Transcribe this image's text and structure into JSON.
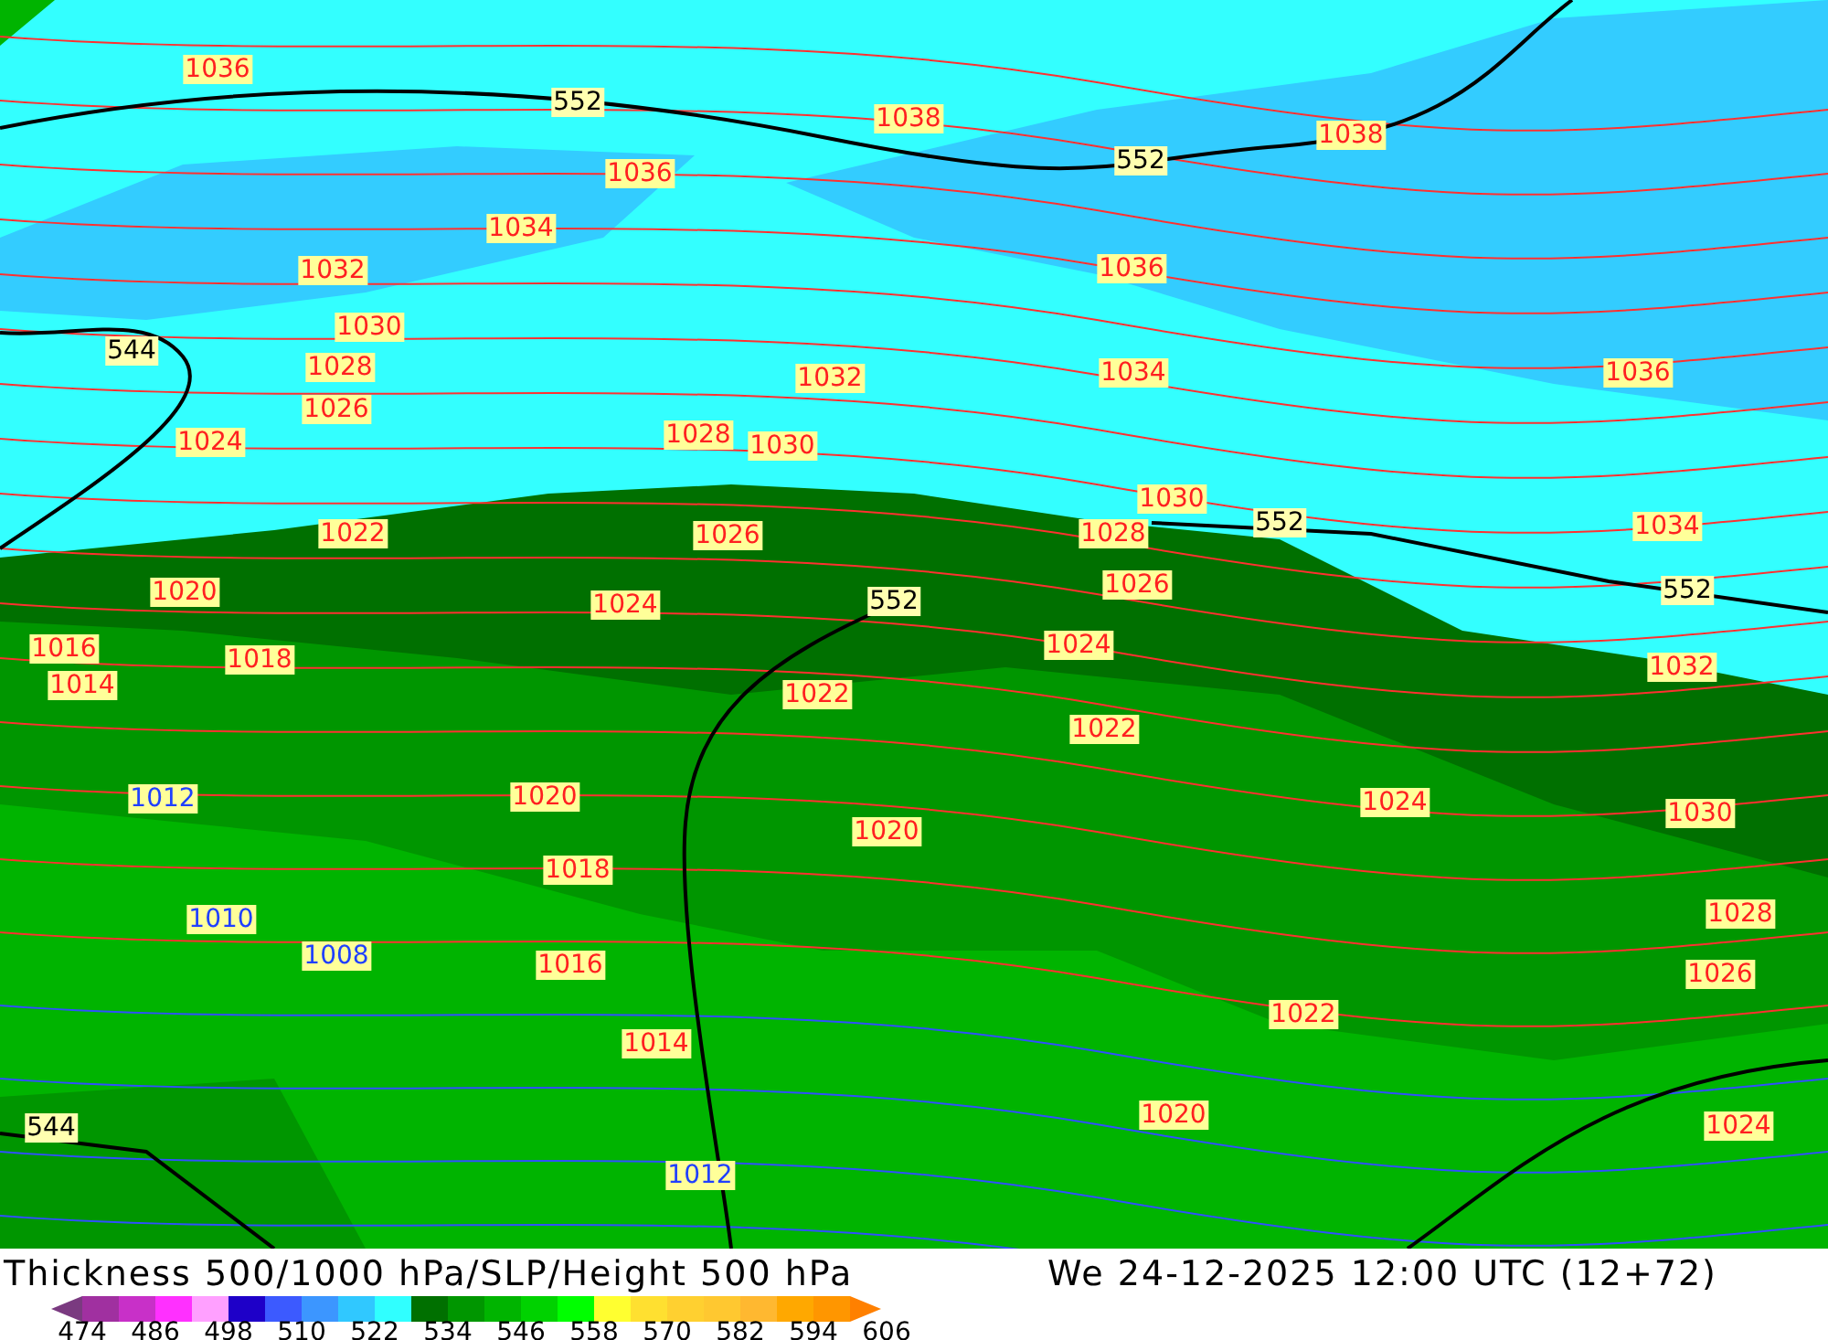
{
  "map": {
    "labels": [
      {
        "text": "1036",
        "kind": "slp"
      },
      {
        "text": "552",
        "kind": "height"
      },
      {
        "text": "1038",
        "kind": "slp"
      },
      {
        "text": "552",
        "kind": "height"
      },
      {
        "text": "1038",
        "kind": "slp"
      },
      {
        "text": "1036",
        "kind": "slp"
      },
      {
        "text": "1034",
        "kind": "slp"
      },
      {
        "text": "1032",
        "kind": "slp"
      },
      {
        "text": "1036",
        "kind": "slp"
      },
      {
        "text": "1030",
        "kind": "slp"
      },
      {
        "text": "544",
        "kind": "height"
      },
      {
        "text": "1028",
        "kind": "slp"
      },
      {
        "text": "1032",
        "kind": "slp"
      },
      {
        "text": "1034",
        "kind": "slp"
      },
      {
        "text": "1036",
        "kind": "slp"
      },
      {
        "text": "1026",
        "kind": "slp"
      },
      {
        "text": "1024",
        "kind": "slp"
      },
      {
        "text": "1028",
        "kind": "slp"
      },
      {
        "text": "1030",
        "kind": "slp"
      },
      {
        "text": "1030",
        "kind": "slp"
      },
      {
        "text": "552",
        "kind": "height"
      },
      {
        "text": "1022",
        "kind": "slp"
      },
      {
        "text": "1026",
        "kind": "slp"
      },
      {
        "text": "1028",
        "kind": "slp"
      },
      {
        "text": "1034",
        "kind": "slp"
      },
      {
        "text": "1020",
        "kind": "slp"
      },
      {
        "text": "1024",
        "kind": "slp"
      },
      {
        "text": "552",
        "kind": "height"
      },
      {
        "text": "1026",
        "kind": "slp"
      },
      {
        "text": "552",
        "kind": "height"
      },
      {
        "text": "1016",
        "kind": "slp"
      },
      {
        "text": "1018",
        "kind": "slp"
      },
      {
        "text": "1014",
        "kind": "slp"
      },
      {
        "text": "1024",
        "kind": "slp"
      },
      {
        "text": "1032",
        "kind": "slp"
      },
      {
        "text": "1022",
        "kind": "slp"
      },
      {
        "text": "1022",
        "kind": "slp"
      },
      {
        "text": "1012",
        "kind": "low"
      },
      {
        "text": "1020",
        "kind": "slp"
      },
      {
        "text": "1024",
        "kind": "slp"
      },
      {
        "text": "1030",
        "kind": "slp"
      },
      {
        "text": "1020",
        "kind": "slp"
      },
      {
        "text": "1018",
        "kind": "slp"
      },
      {
        "text": "1010",
        "kind": "low"
      },
      {
        "text": "1028",
        "kind": "slp"
      },
      {
        "text": "1008",
        "kind": "low"
      },
      {
        "text": "1016",
        "kind": "slp"
      },
      {
        "text": "1026",
        "kind": "slp"
      },
      {
        "text": "1022",
        "kind": "slp"
      },
      {
        "text": "1014",
        "kind": "slp"
      },
      {
        "text": "1020",
        "kind": "slp"
      },
      {
        "text": "544",
        "kind": "height"
      },
      {
        "text": "1024",
        "kind": "slp"
      },
      {
        "text": "1012",
        "kind": "low"
      }
    ]
  },
  "title": "Thickness 500/1000 hPa/SLP/Height 500 hPa",
  "valid_time": "We 24-12-2025 12:00 UTC (12+72)",
  "legend": {
    "swatches": [
      {
        "color": "#7a3a80"
      },
      {
        "color": "#a030a0"
      },
      {
        "color": "#c830c8"
      },
      {
        "color": "#ff30ff"
      },
      {
        "color": "#ffa0ff"
      },
      {
        "color": "#1e00c8"
      },
      {
        "color": "#3c5aff"
      },
      {
        "color": "#3c96ff"
      },
      {
        "color": "#30c8ff"
      },
      {
        "color": "#30ffff"
      },
      {
        "color": "#007000"
      },
      {
        "color": "#009600"
      },
      {
        "color": "#00b400"
      },
      {
        "color": "#00d200"
      },
      {
        "color": "#00ff00"
      },
      {
        "color": "#ffff30"
      },
      {
        "color": "#ffe030"
      },
      {
        "color": "#ffd030"
      },
      {
        "color": "#ffc830"
      },
      {
        "color": "#ffb830"
      },
      {
        "color": "#ffa800"
      },
      {
        "color": "#ff9600"
      },
      {
        "color": "#ff8000"
      }
    ],
    "ticks": [
      "474",
      "486",
      "498",
      "510",
      "522",
      "534",
      "546",
      "558",
      "570",
      "582",
      "594",
      "606"
    ]
  }
}
